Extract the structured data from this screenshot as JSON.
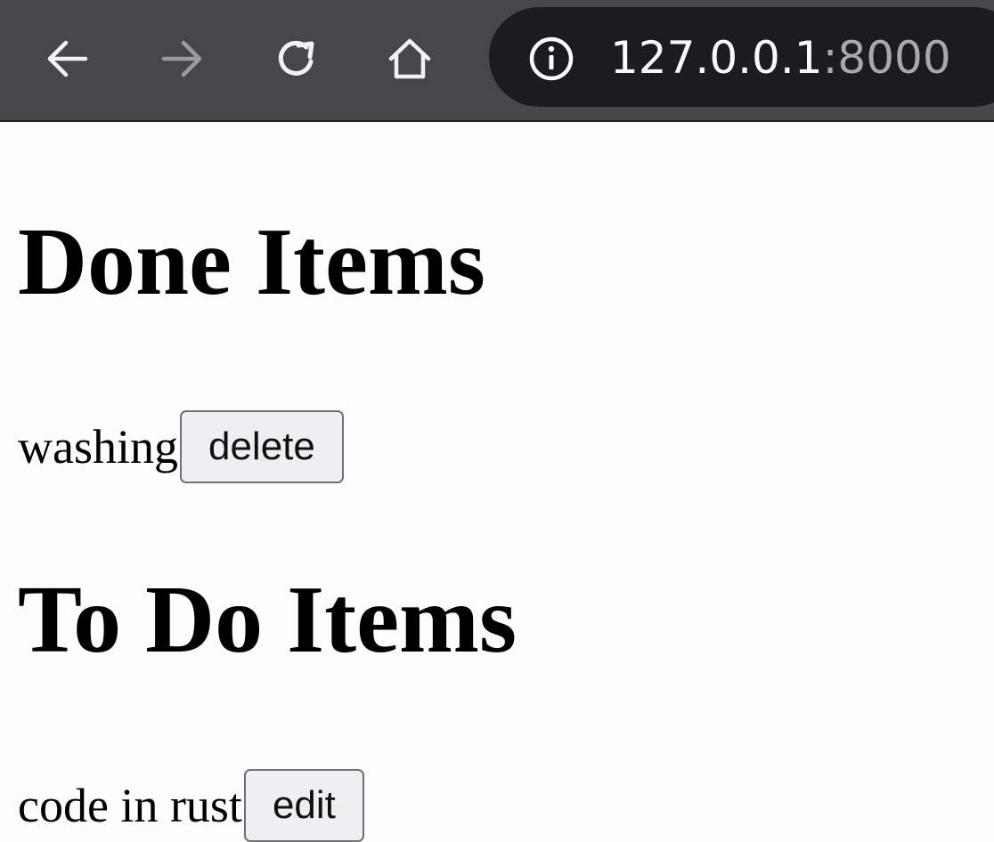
{
  "browser": {
    "url_host": "127.0.0.1",
    "url_port": ":8000"
  },
  "done_section": {
    "heading": "Done Items",
    "items": [
      {
        "label": "washing",
        "button": "delete"
      }
    ]
  },
  "todo_section": {
    "heading": "To Do Items",
    "items": [
      {
        "label": "code in rust",
        "button": "edit"
      }
    ]
  },
  "colors": {
    "toolbar_bg": "#47474a",
    "urlbar_bg": "#1c1b22",
    "page_bg": "#fdfdfd"
  },
  "icons": [
    "back-arrow-icon",
    "forward-arrow-icon",
    "reload-icon",
    "home-icon",
    "info-icon"
  ]
}
